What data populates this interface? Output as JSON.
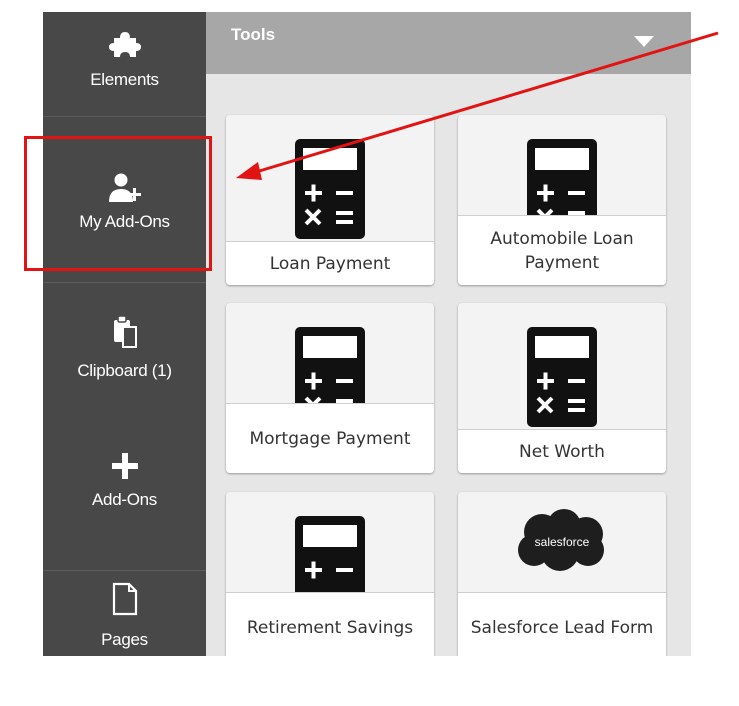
{
  "sidebar": {
    "items": [
      {
        "label": "Elements",
        "icon": "puzzle-icon"
      },
      {
        "label": "My Add-Ons",
        "icon": "user-add-icon"
      },
      {
        "label": "Clipboard (1)",
        "icon": "clipboard-icon"
      },
      {
        "label": "Add-Ons",
        "icon": "plus-icon"
      },
      {
        "label": "Pages",
        "icon": "page-icon"
      }
    ]
  },
  "panel": {
    "title": "Tools",
    "tiles": [
      {
        "label": "Loan Payment",
        "icon": "calculator-icon"
      },
      {
        "label": "Automobile Loan Payment",
        "icon": "calculator-icon"
      },
      {
        "label": "Mortgage Payment",
        "icon": "calculator-icon"
      },
      {
        "label": "Net Worth",
        "icon": "calculator-icon"
      },
      {
        "label": "Retirement Savings",
        "icon": "calculator-icon"
      },
      {
        "label": "Salesforce Lead Form",
        "icon": "salesforce-cloud-icon",
        "logo_text": "salesforce"
      }
    ]
  },
  "colors": {
    "sidebar_bg": "#484848",
    "header_bg": "#a7a7a7",
    "panel_bg": "#e6e6e6",
    "annotation_red": "#e21313",
    "salesforce_blue": "#222222"
  }
}
